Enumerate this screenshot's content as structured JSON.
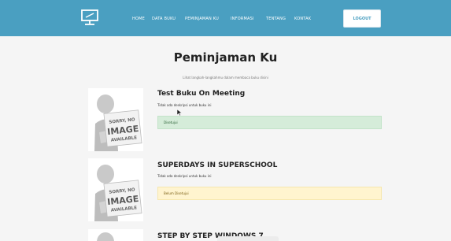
{
  "nav": {
    "links": [
      "HOME",
      "DATA BUKU",
      "PEMINJAMAN KU",
      "INFORMASI",
      "TENTANG",
      "KONTAK"
    ],
    "logout_label": "LOGOUT",
    "colors": {
      "bar": "#4a9fc1",
      "text": "#ffffff"
    },
    "logo_icon": "monitor-icon"
  },
  "page": {
    "title": "Peminjaman Ku",
    "subtitle": "Lihat langkah-langkahmu dalam membaca buku disini"
  },
  "books": [
    {
      "title": "Test Buku On Meeting",
      "description": "Tidak ada deskripsi untuk buku ini",
      "status": "Disetujui",
      "status_type": "approved"
    },
    {
      "title": "SUPERDAYS IN SUPERSCHOOL",
      "description": "Tidak ada deskripsi untuk buku ini",
      "status": "Belum Disetujui",
      "status_type": "pending"
    },
    {
      "title": "STEP BY STEP WINDOWS 7",
      "description": "",
      "status": "",
      "status_type": ""
    }
  ],
  "cover_placeholder": {
    "line1": "SORRY, NO",
    "line2": "IMAGE",
    "line3": "AVAILABLE"
  },
  "status_colors": {
    "approved": "#d5ecd9",
    "pending": "#fff4cf"
  }
}
